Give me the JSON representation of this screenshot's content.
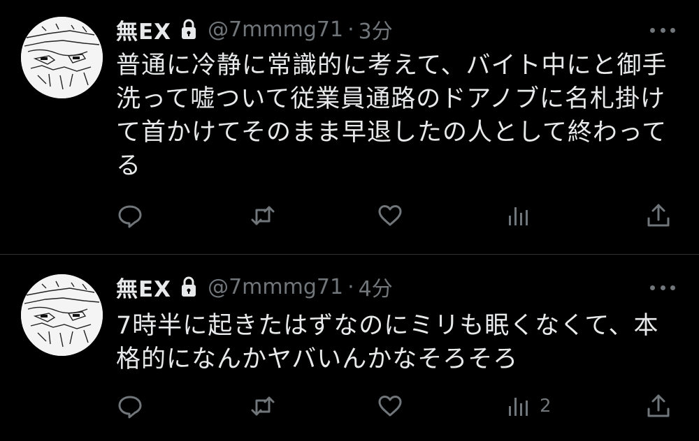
{
  "tweets": [
    {
      "name": "無EX",
      "handle": "@7mmmg71",
      "separator": "·",
      "time": "3分",
      "text": "普通に冷静に常識的に考えて、バイト中にと御手洗って嘘ついて従業員通路のドアノブに名札掛けて首かけてそのまま早退したの人として終わってる",
      "reply_count": "",
      "retweet_count": "",
      "like_count": "",
      "view_count": "",
      "locked": true,
      "icons": [
        "lock-icon",
        "more-icon",
        "reply-icon",
        "retweet-icon",
        "like-icon",
        "views-icon",
        "share-icon"
      ]
    },
    {
      "name": "無EX",
      "handle": "@7mmmg71",
      "separator": "·",
      "time": "4分",
      "text": "7時半に起きたはずなのにミリも眠くなくて、本格的になんかヤバいんかなそろそろ",
      "reply_count": "",
      "retweet_count": "",
      "like_count": "",
      "view_count": "2",
      "locked": true,
      "icons": [
        "lock-icon",
        "more-icon",
        "reply-icon",
        "retweet-icon",
        "like-icon",
        "views-icon",
        "share-icon"
      ]
    }
  ],
  "colors": {
    "background": "#000000",
    "text": "#e7e9ea",
    "muted": "#71767b",
    "divider": "#2f3336"
  }
}
